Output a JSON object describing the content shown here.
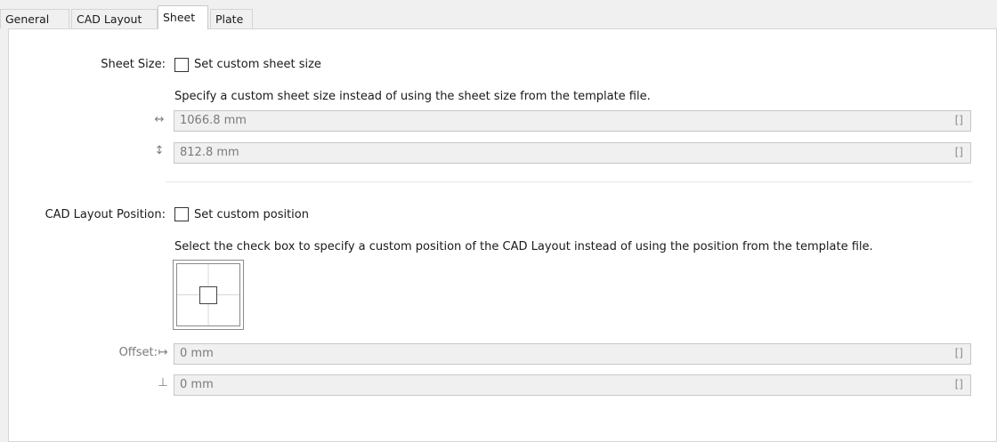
{
  "tabs": [
    {
      "label": "General"
    },
    {
      "label": "CAD Layout"
    },
    {
      "label": "Sheet"
    },
    {
      "label": "Plate"
    }
  ],
  "sheet_size": {
    "label": "Sheet Size:",
    "checkbox_label": "Set custom sheet size",
    "checked": false,
    "description": "Specify a custom sheet size instead of using the sheet size from the template file.",
    "width_symbol": "↔",
    "width_value": "1066.8 mm",
    "height_symbol": "↕",
    "height_value": "812.8 mm",
    "bracket": "[]"
  },
  "cad_layout_position": {
    "label": "CAD Layout Position:",
    "checkbox_label": "Set custom position",
    "checked": false,
    "description": "Select the check box to specify a custom position of the CAD Layout instead of using the position from the template file.",
    "offset_label": "Offset:",
    "offset_x_symbol": "↦",
    "offset_x_value": "0 mm",
    "offset_y_symbol": "⊥",
    "offset_y_value": "0 mm",
    "bracket": "[]"
  },
  "colors": {
    "panel_bg": "#ffffff",
    "window_bg": "#f0f0f0",
    "field_bg": "#f0f0f0",
    "disabled_text": "#7a7a7a"
  }
}
